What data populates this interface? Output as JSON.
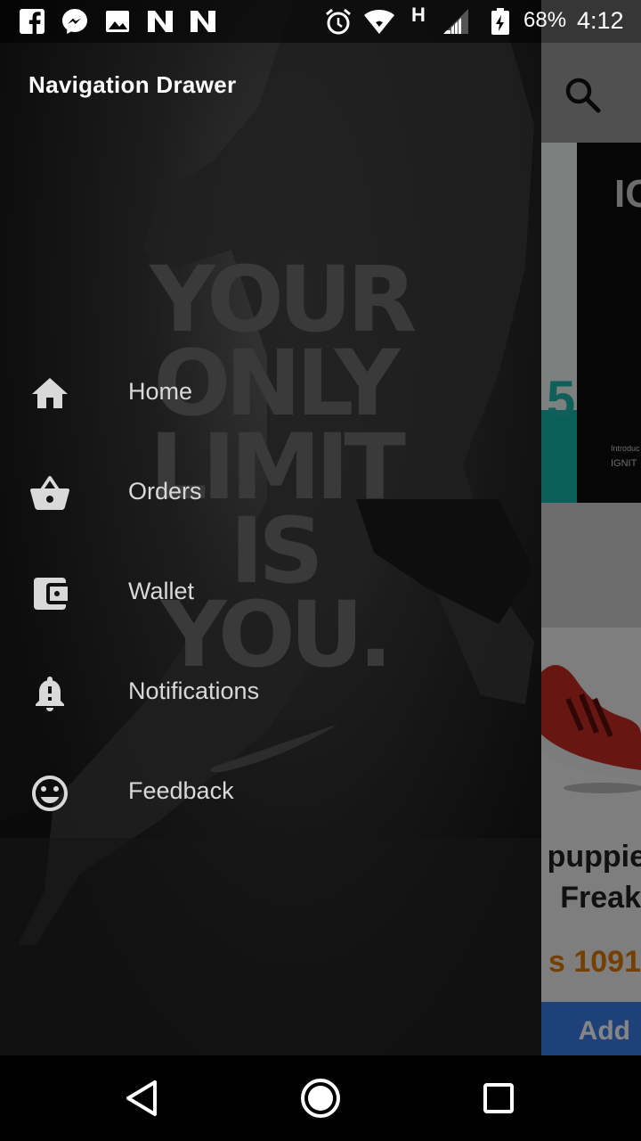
{
  "status_bar": {
    "notification_icons": [
      "facebook-icon",
      "messenger-icon",
      "image-icon",
      "n-icon",
      "n-icon"
    ],
    "system_icons": [
      "alarm-icon",
      "wifi-icon",
      "network-type-icon",
      "signal-icon",
      "battery-icon"
    ],
    "network_type": "H",
    "battery_percent": "68%",
    "time": "4:12"
  },
  "drawer": {
    "title": "Navigation Drawer",
    "background_slogan_lines": [
      "YOUR",
      "ONLY",
      "LIMIT",
      "IS",
      "YOU."
    ],
    "items": [
      {
        "label": "Home",
        "icon": "home-icon"
      },
      {
        "label": "Orders",
        "icon": "basket-icon"
      },
      {
        "label": "Wallet",
        "icon": "wallet-icon"
      },
      {
        "label": "Notifications",
        "icon": "bell-alert-icon"
      },
      {
        "label": "Feedback",
        "icon": "smiley-icon"
      }
    ]
  },
  "background_app": {
    "search_icon": "search-icon",
    "banner_partial_text": "IC",
    "banner_small_text_1": "Introduc",
    "banner_small_text_2": "IGNIT",
    "product_name_line1": "puppie",
    "product_name_line2": "Freak",
    "product_price": "s 1091",
    "add_button_label": "Add",
    "colors": {
      "price": "#e07a00",
      "add_button": "#3d7ee8"
    }
  },
  "nav_bar": {
    "buttons": [
      "back-icon",
      "home-circle-icon",
      "recents-icon"
    ]
  }
}
